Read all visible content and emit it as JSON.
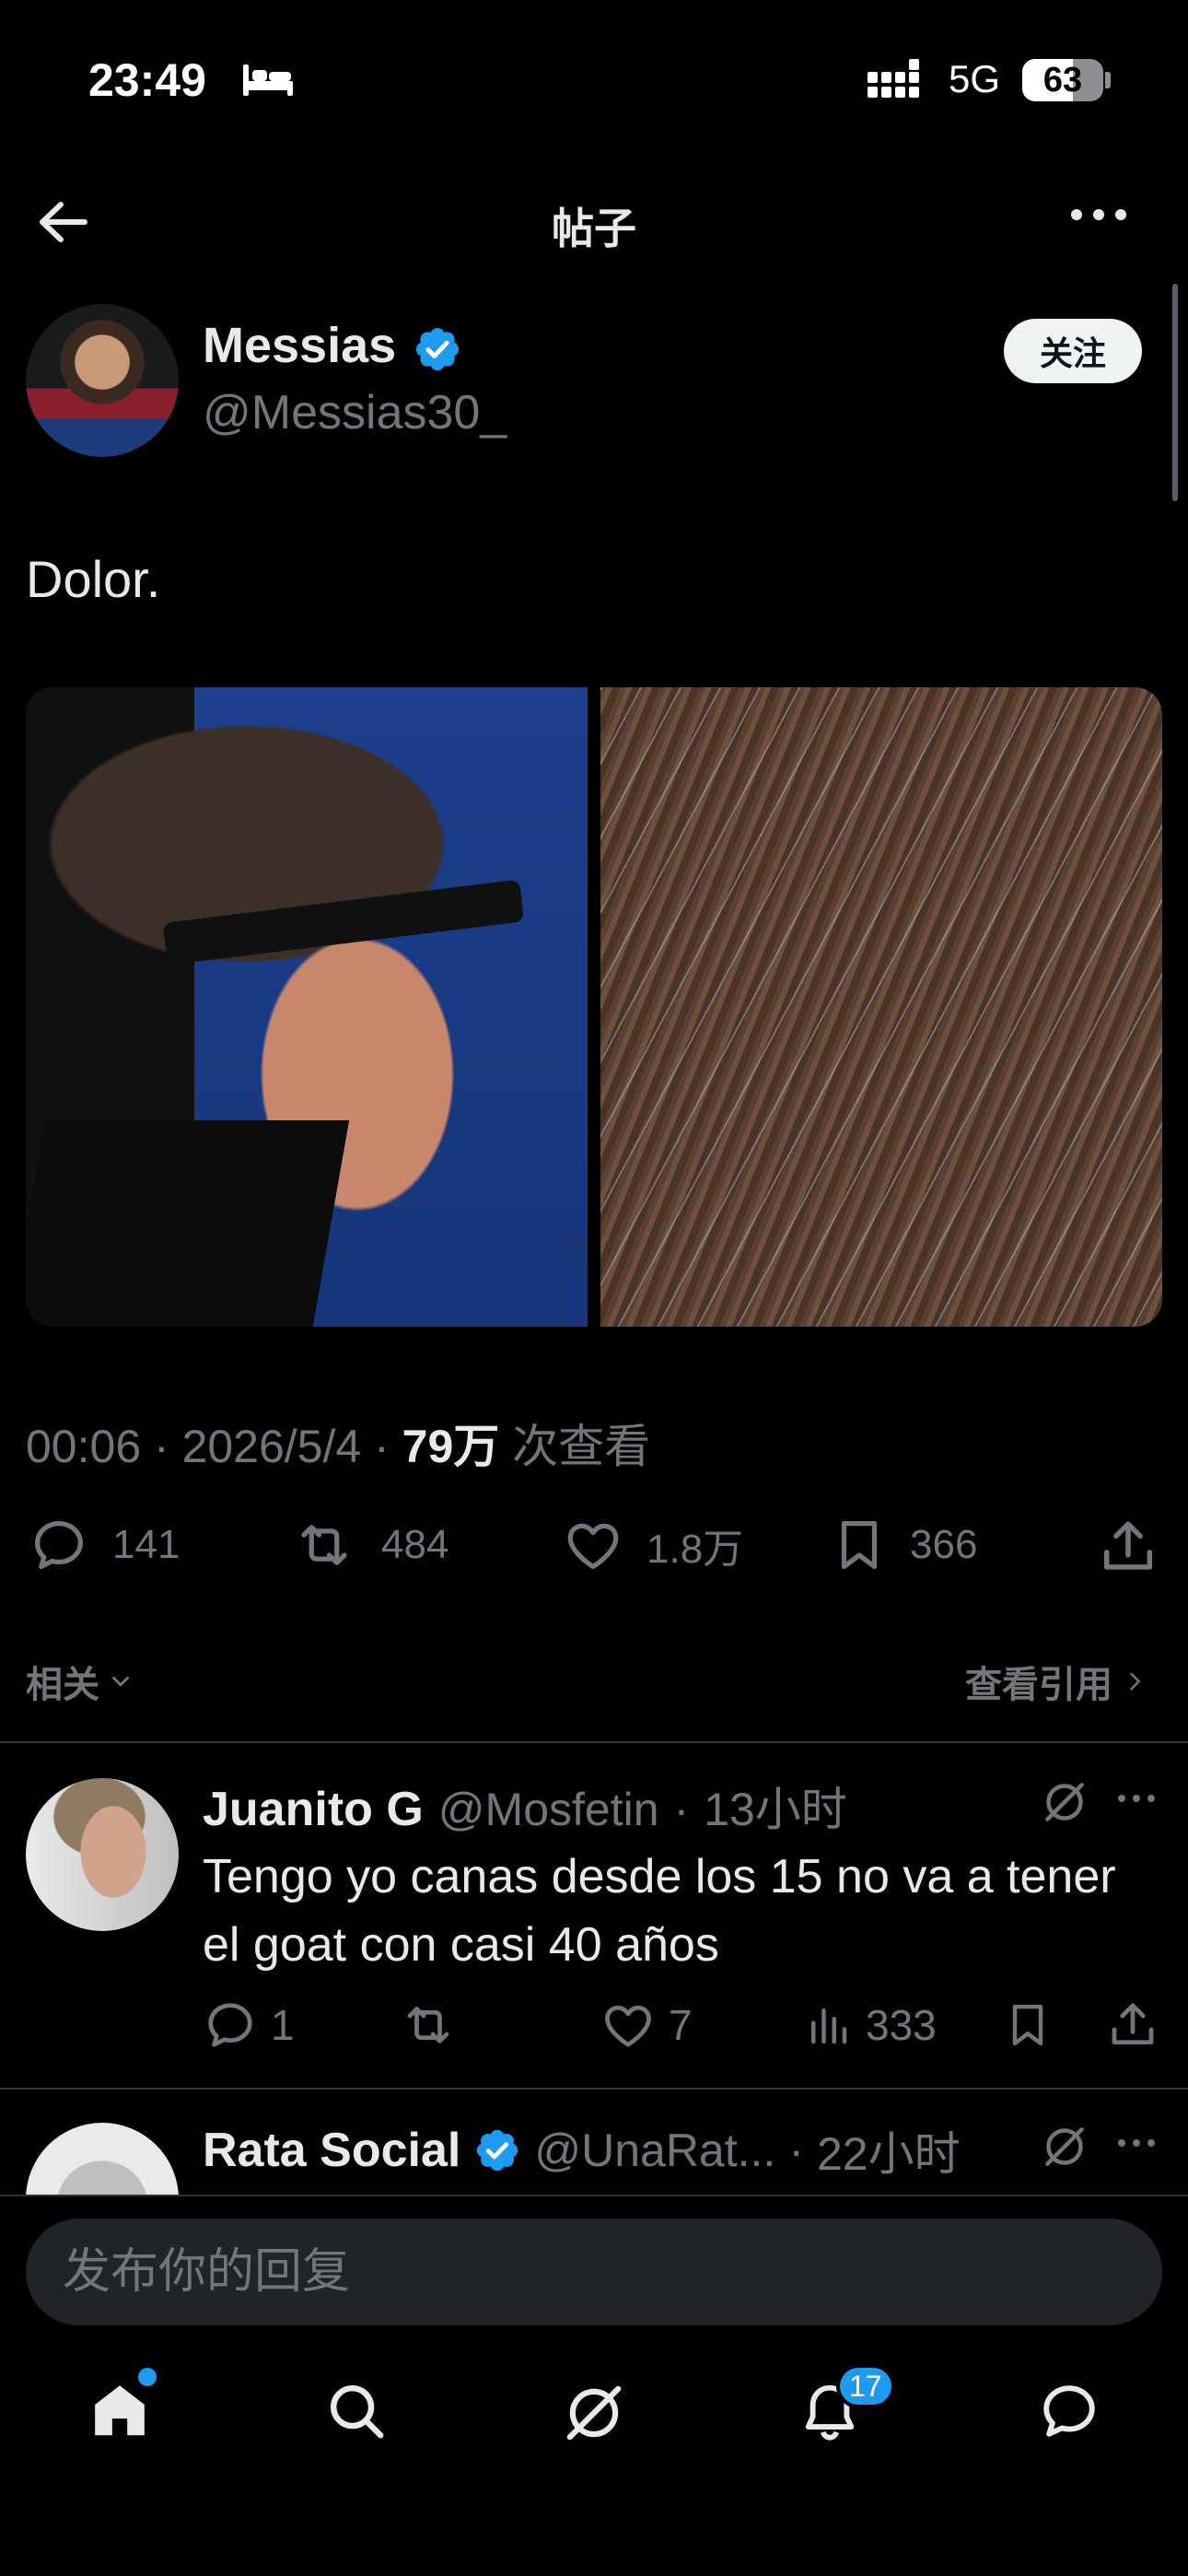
{
  "status_bar": {
    "time": "23:49",
    "network": "5G",
    "battery": "63",
    "battery_level": 0.63
  },
  "header": {
    "title": "帖子"
  },
  "post": {
    "author_name": "Messias",
    "author_handle": "@Messias30_",
    "follow_label": "关注",
    "text": "Dolor.",
    "time": "00:06",
    "date": "2026/5/4",
    "views_count": "79万",
    "views_label": "次查看",
    "stats": {
      "replies": "141",
      "reposts": "484",
      "likes": "1.8万",
      "bookmarks": "366"
    }
  },
  "related": {
    "label": "相关",
    "quotes_label": "查看引用"
  },
  "replies": [
    {
      "name": "Juanito G",
      "handle": "@Mosfetin",
      "time": "13小时",
      "text": "Tengo yo canas desde los 15 no va a tener el goat con casi 40 años",
      "replies": "1",
      "likes": "7",
      "views": "333"
    },
    {
      "name": "Rata Social",
      "handle": "@UnaRat...",
      "time": "22小时"
    }
  ],
  "composer": {
    "placeholder": "发布你的回复"
  },
  "bottom_nav": {
    "notification_count": "17"
  },
  "colors": {
    "accent": "#1d9bf0",
    "background": "#000000",
    "muted_text": "#71767b",
    "text": "#e7e9ea"
  },
  "icons": [
    "back-arrow-icon",
    "more-icon",
    "verified-badge-icon",
    "reply-icon",
    "repost-icon",
    "like-icon",
    "bookmark-icon",
    "share-icon",
    "grok-icon",
    "views-icon",
    "home-icon",
    "search-icon",
    "notifications-icon",
    "messages-icon"
  ]
}
